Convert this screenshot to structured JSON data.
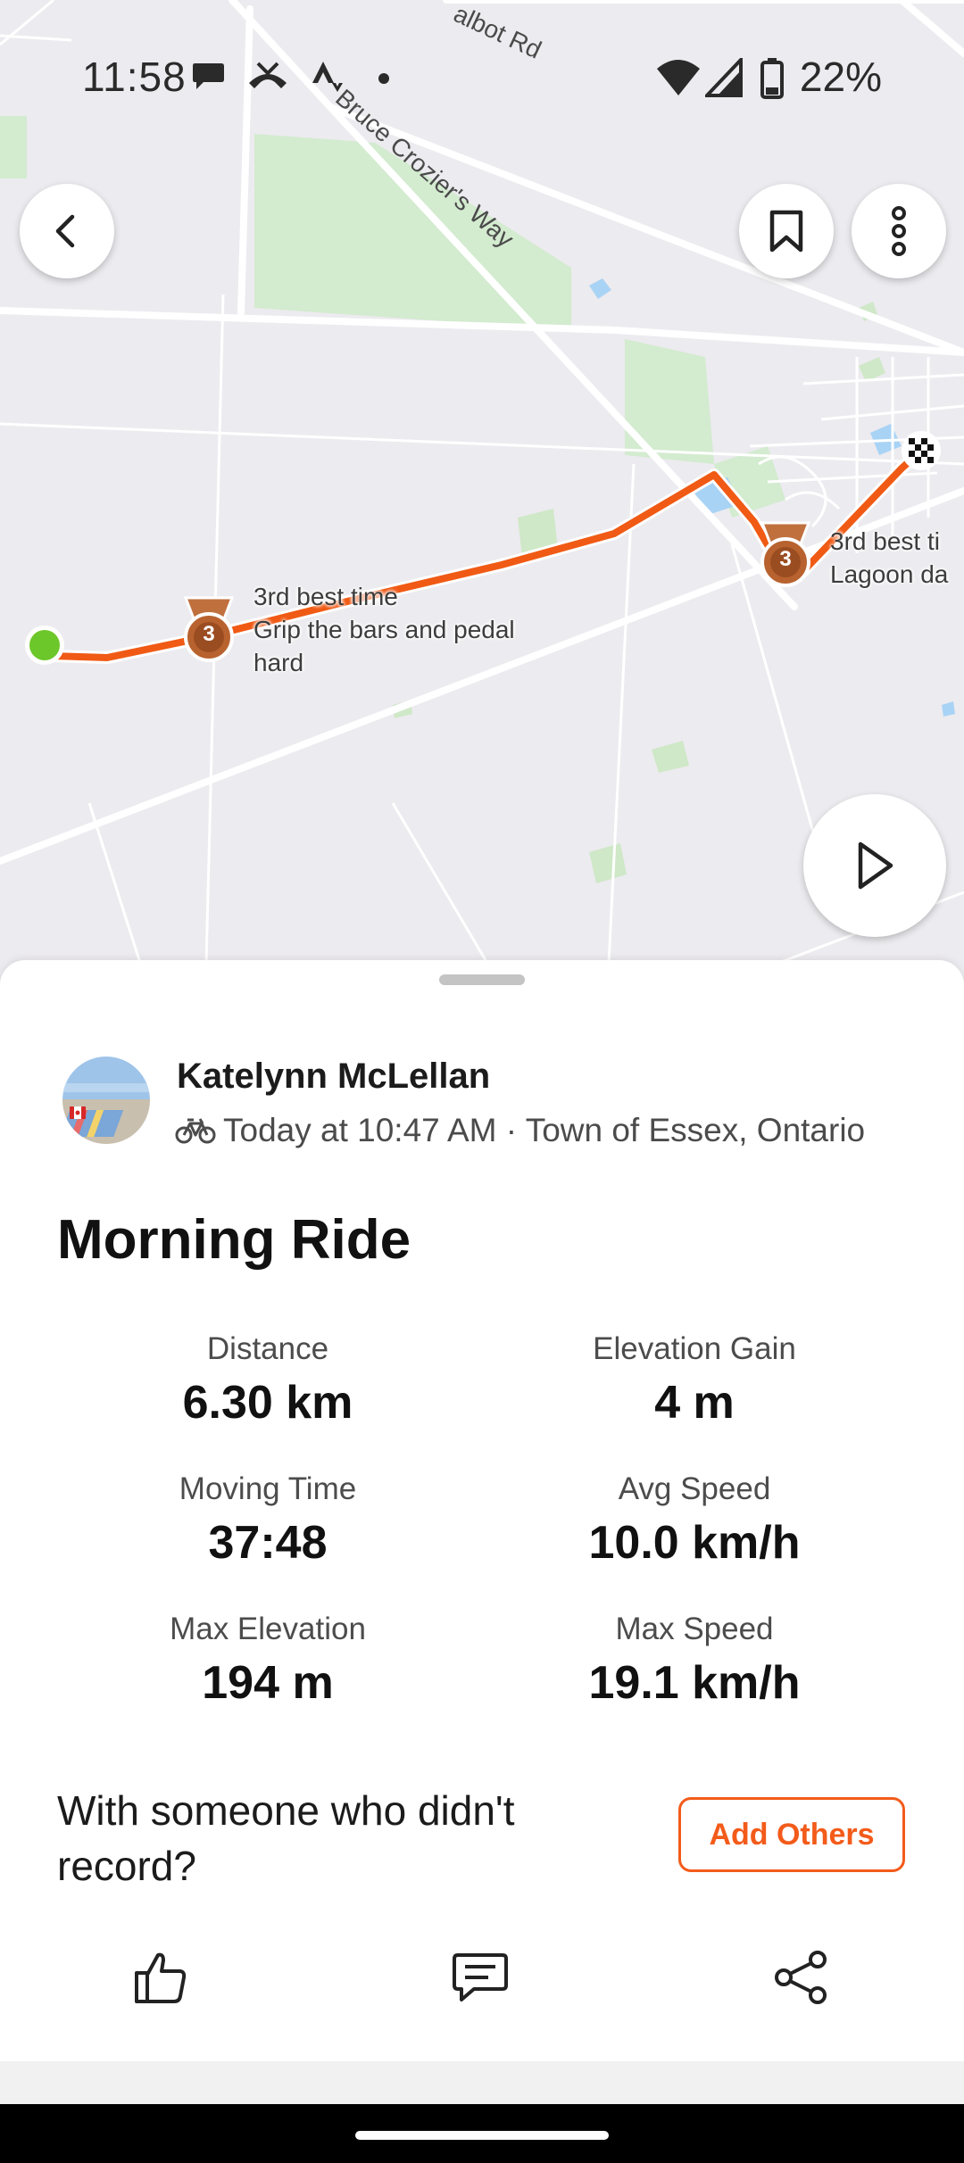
{
  "status_bar": {
    "time": "11:58",
    "battery": "22%"
  },
  "map": {
    "road_labels": [
      "albot Rd",
      "Bruce Crozier's Way"
    ],
    "segments": [
      {
        "line1": "3rd best time",
        "line2": "Grip the bars and pedal",
        "line3": "hard",
        "rank": "3"
      },
      {
        "line1": "3rd best ti",
        "line2": "Lagoon da",
        "rank": "3"
      }
    ],
    "route_color": "#f05a14",
    "start_color": "#6cc72a"
  },
  "activity": {
    "athlete_name": "Katelynn McLellan",
    "meta": "Today at 10:47 AM · Town of Essex, Ontario",
    "title": "Morning Ride",
    "stats": {
      "distance": {
        "label": "Distance",
        "value": "6.30 km"
      },
      "elevation_gain": {
        "label": "Elevation Gain",
        "value": "4 m"
      },
      "moving_time": {
        "label": "Moving Time",
        "value": "37:48"
      },
      "avg_speed": {
        "label": "Avg Speed",
        "value": "10.0 km/h"
      },
      "max_elevation": {
        "label": "Max Elevation",
        "value": "194 m"
      },
      "max_speed": {
        "label": "Max Speed",
        "value": "19.1 km/h"
      }
    },
    "with_someone": "With someone who didn't record?",
    "add_others": "Add Others",
    "accent_color": "#f35b1a"
  },
  "icons": {
    "back": "chevron-left-icon",
    "bookmark": "bookmark-icon",
    "more": "more-vertical-icon",
    "play": "play-icon",
    "bike": "bike-icon",
    "kudos": "thumbs-up-icon",
    "comment": "comment-icon",
    "share": "share-icon"
  }
}
